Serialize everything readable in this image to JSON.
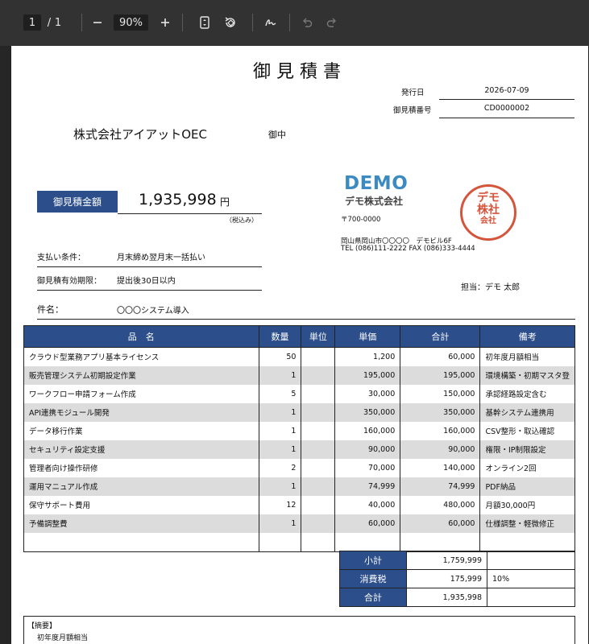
{
  "viewer": {
    "page_current": "1",
    "page_sep": "/",
    "page_total": "1",
    "zoom": "90%"
  },
  "doc": {
    "title": "御見積書",
    "issue_date_label": "発行日",
    "issue_date": "2026-07-09",
    "quote_no_label": "御見積番号",
    "quote_no": "CD0000002",
    "client": "株式会社アイアットOEC",
    "honorific": "御中",
    "amount_label": "御見積金額",
    "amount": "1,935,998",
    "yen": "円",
    "tax_note": "（税込み）",
    "payment_label": "支払い条件：",
    "payment_value": "月末締め翌月末一括払い",
    "validity_label": "御見積有効期限：",
    "validity_value": "提出後30日以内",
    "subject_label": "件名：",
    "subject_value": "〇〇〇システム導入"
  },
  "company": {
    "logo_word": "DEMO",
    "logo_name": "デモ株式会社",
    "postal": "〒700-0000",
    "address": "岡山県岡山市〇〇〇〇　デモビル6F",
    "tel_fax": "TEL (086)111-2222 FAX (086)333-4444",
    "stamp_line1": "デモ",
    "stamp_line2": "株社",
    "stamp_line3": "会社",
    "contact": "担当：デモ 太郎"
  },
  "table": {
    "headers": [
      "品　名",
      "数量",
      "単位",
      "単価",
      "合計",
      "備考"
    ],
    "rows": [
      {
        "name": "クラウド型業務アプリ基本ライセンス",
        "qty": "50",
        "unit": "",
        "price": "1,200",
        "total": "60,000",
        "note": "初年度月額相当"
      },
      {
        "name": "販売管理システム初期設定作業",
        "qty": "1",
        "unit": "",
        "price": "195,000",
        "total": "195,000",
        "note": "環境構築・初期マスタ登"
      },
      {
        "name": "ワークフロー申請フォーム作成",
        "qty": "5",
        "unit": "",
        "price": "30,000",
        "total": "150,000",
        "note": "承認経路設定含む"
      },
      {
        "name": "API連携モジュール開発",
        "qty": "1",
        "unit": "",
        "price": "350,000",
        "total": "350,000",
        "note": "基幹システム連携用"
      },
      {
        "name": "データ移行作業",
        "qty": "1",
        "unit": "",
        "price": "160,000",
        "total": "160,000",
        "note": "CSV整形・取込確認"
      },
      {
        "name": "セキュリティ設定支援",
        "qty": "1",
        "unit": "",
        "price": "90,000",
        "total": "90,000",
        "note": "権限・IP制限設定"
      },
      {
        "name": "管理者向け操作研修",
        "qty": "2",
        "unit": "",
        "price": "70,000",
        "total": "140,000",
        "note": "オンライン2回"
      },
      {
        "name": "運用マニュアル作成",
        "qty": "1",
        "unit": "",
        "price": "74,999",
        "total": "74,999",
        "note": "PDF納品"
      },
      {
        "name": "保守サポート費用",
        "qty": "12",
        "unit": "",
        "price": "40,000",
        "total": "480,000",
        "note": "月額30,000円"
      },
      {
        "name": "予備調整費",
        "qty": "1",
        "unit": "",
        "price": "60,000",
        "total": "60,000",
        "note": "仕様調整・軽微修正"
      }
    ]
  },
  "totals": {
    "subtotal_label": "小計",
    "subtotal": "1,759,999",
    "tax_label": "消費税",
    "tax": "175,999",
    "tax_rate": "10%",
    "total_label": "合計",
    "total": "1,935,998"
  },
  "summary": {
    "label": "【摘要】",
    "text": "初年度月額相当"
  },
  "colors": {
    "header_blue": "#2c4f8c",
    "alt_row_gray": "#dcdcdc",
    "stamp_red": "#d4553b",
    "logo_blue": "#3b8bc2"
  }
}
